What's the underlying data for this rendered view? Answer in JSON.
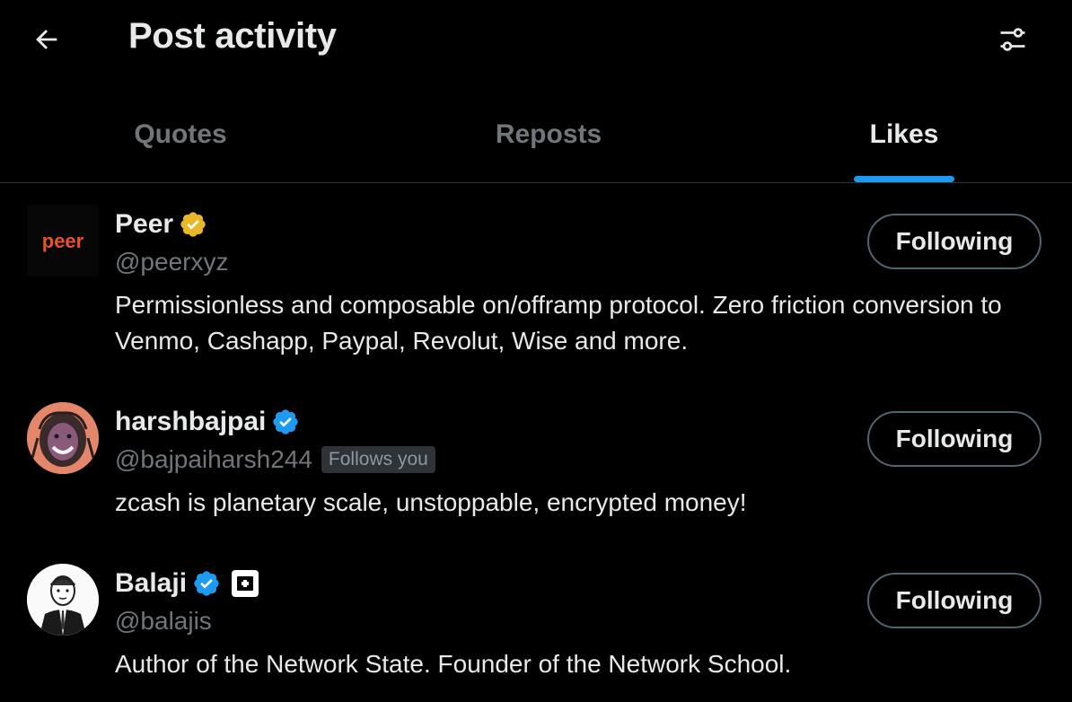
{
  "header": {
    "title": "Post activity",
    "back_icon": "arrow-left-icon",
    "filter_icon": "sliders-icon"
  },
  "tabs": [
    {
      "label": "Quotes",
      "active": false
    },
    {
      "label": "Reposts",
      "active": false
    },
    {
      "label": "Likes",
      "active": true
    }
  ],
  "colors": {
    "accent": "#1d9bf0",
    "gold_verified": "#e8b829",
    "blue_verified": "#1d9bf0",
    "background": "#000000",
    "secondary_text": "#71767b"
  },
  "users": [
    {
      "avatar_text": "peer",
      "display_name": "Peer",
      "verified": "gold",
      "handle": "@peerxyz",
      "follows_you": "",
      "bio": "Permissionless and composable on/offramp protocol. Zero friction conversion to Venmo, Cashapp, Paypal, Revolut, Wise and more.",
      "button_label": "Following"
    },
    {
      "display_name": "harshbajpai",
      "verified": "blue",
      "handle": "@bajpaiharsh244",
      "follows_you": "Follows you",
      "bio": "zcash is planetary scale, unstoppable, encrypted money!",
      "button_label": "Following"
    },
    {
      "display_name": "Balaji",
      "verified": "blue",
      "handle": "@balajis",
      "follows_you": "",
      "bio": "Author of the Network State. Founder of the Network School.",
      "button_label": "Following"
    }
  ]
}
